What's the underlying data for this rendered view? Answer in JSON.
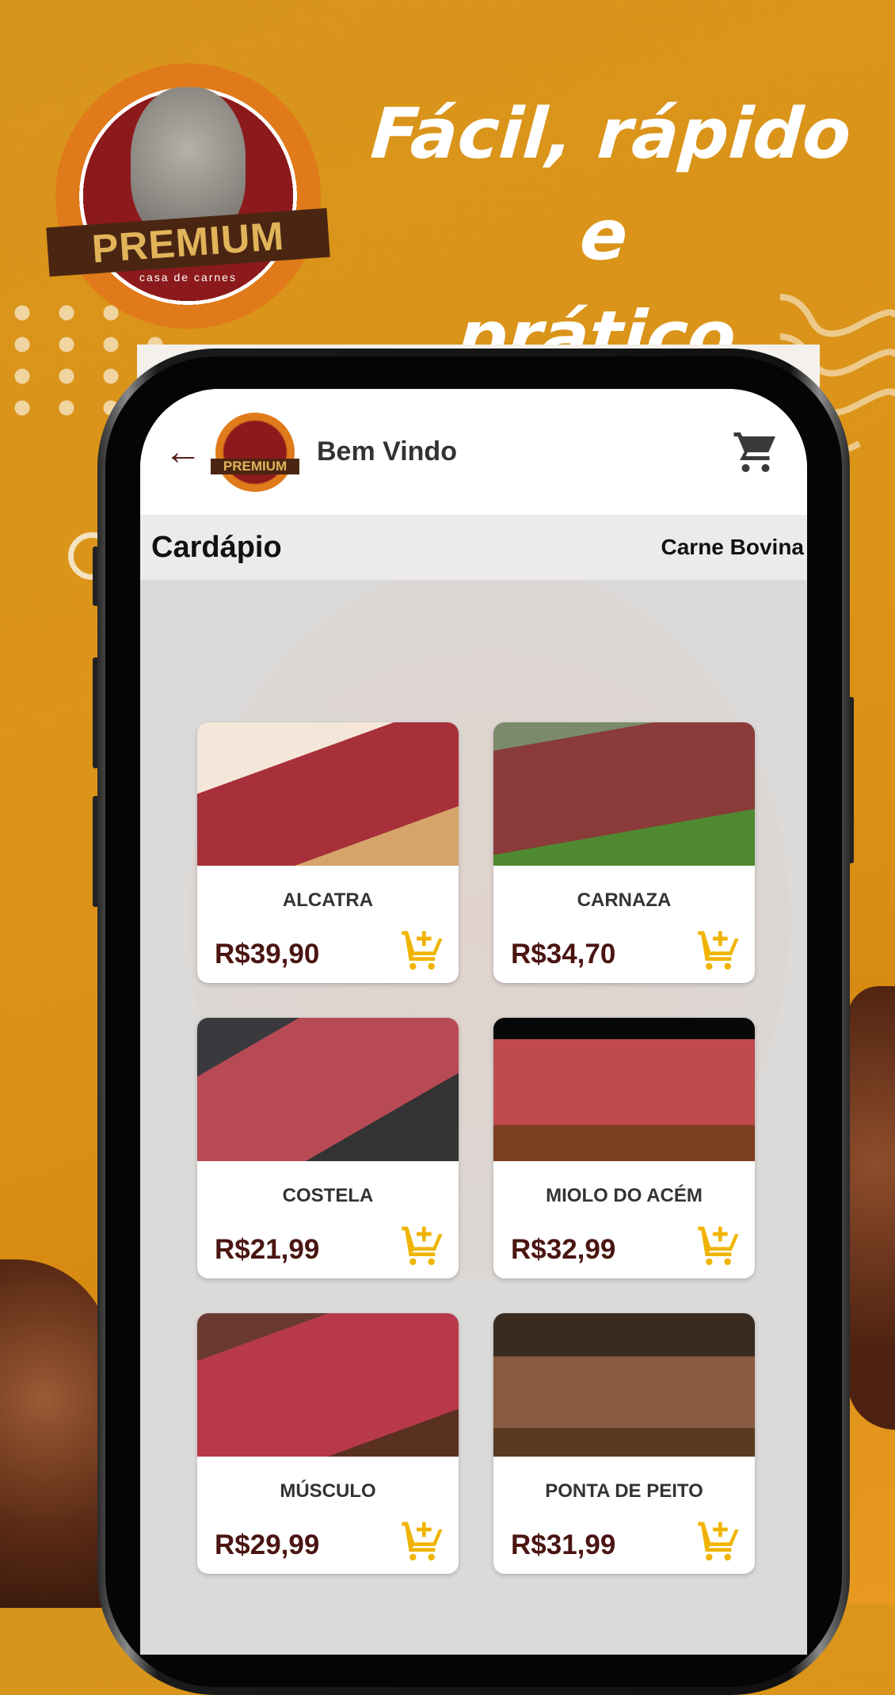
{
  "promo": {
    "headline_line1": "Fácil, rápido e",
    "headline_line2": "prático",
    "logo_text": "PREMIUM",
    "logo_subtext": "casa de carnes"
  },
  "app": {
    "header": {
      "back_icon": "arrow-left-icon",
      "logo_text": "PREMIUM",
      "title": "Bem Vindo",
      "cart_icon": "cart-icon"
    },
    "bar": {
      "title": "Cardápio",
      "category": "Carne Bovina"
    },
    "products": [
      {
        "name": "ALCATRA",
        "price": "R$39,90"
      },
      {
        "name": "CARNAZA",
        "price": "R$34,70"
      },
      {
        "name": "COSTELA",
        "price": "R$21,99"
      },
      {
        "name": "MIOLO DO ACÉM",
        "price": "R$32,99"
      },
      {
        "name": "MÚSCULO",
        "price": "R$29,99"
      },
      {
        "name": "PONTA DE PEITO",
        "price": "R$31,99"
      }
    ]
  },
  "colors": {
    "background": "#dc9418",
    "price": "#4a1512",
    "add_cart": "#f0b400",
    "back_arrow": "#5a1e1a"
  }
}
